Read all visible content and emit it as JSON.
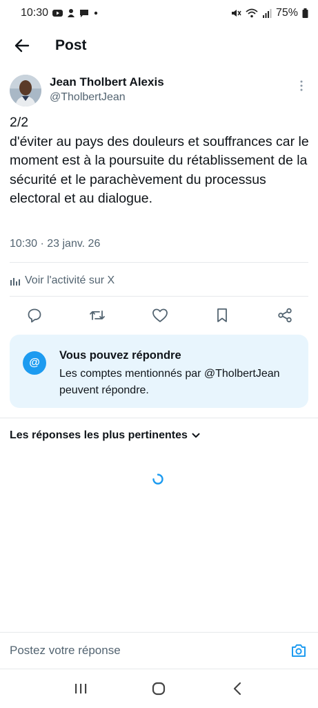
{
  "status_bar": {
    "time": "10:30",
    "battery": "75%",
    "icons": [
      "youtube-icon",
      "notification-icon",
      "chat-icon",
      "dot-icon",
      "mute-icon",
      "wifi-icon",
      "signal-icon",
      "battery-icon"
    ]
  },
  "header": {
    "title": "Post",
    "back_icon": "arrow-left-icon"
  },
  "post": {
    "author_name": "Jean Tholbert Alexis",
    "author_handle": "@TholbertJean",
    "text": "2/2\nd'éviter au pays des douleurs et souffrances car le moment est à la poursuite du rétablissement de la sécurité et le parachèvement du processus electoral et au dialogue.",
    "timestamp": "10:30 · 23 janv. 26",
    "activity_label": "Voir l'activité sur X"
  },
  "actions": [
    "reply-icon",
    "repost-icon",
    "like-icon",
    "bookmark-icon",
    "share-icon"
  ],
  "reply_info": {
    "icon_text": "@",
    "title": "Vous pouvez répondre",
    "description": "Les comptes mentionnés par @TholbertJean peuvent répondre."
  },
  "replies": {
    "sort_label": "Les réponses les plus pertinentes"
  },
  "composer": {
    "placeholder": "Postez votre réponse"
  },
  "colors": {
    "accent": "#1d9bf0",
    "text_primary": "#0f1419",
    "text_secondary": "#536471",
    "card_bg": "#e8f5fd"
  }
}
